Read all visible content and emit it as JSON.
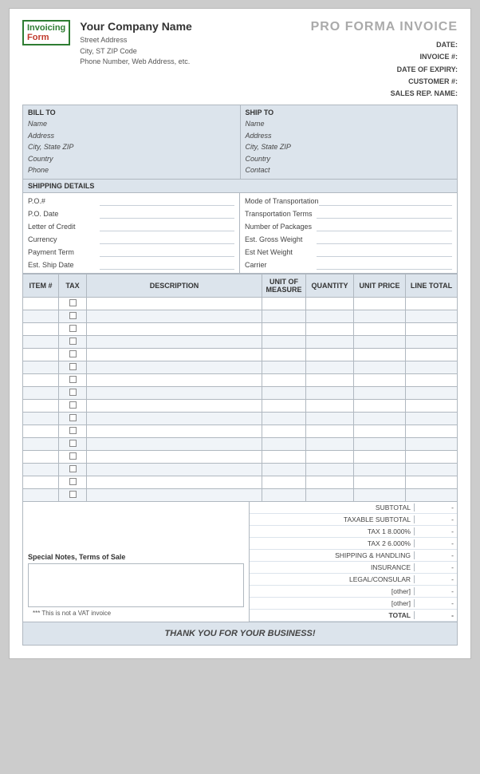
{
  "page": {
    "title": "PRO FORMA INVOICE"
  },
  "company": {
    "name": "Your Company Name",
    "address": "Street Address",
    "city_zip": "City, ST  ZIP Code",
    "phone": "Phone Number, Web Address, etc."
  },
  "logo": {
    "invoicing": "Invoicing",
    "form": "Form"
  },
  "invoice_fields": {
    "date_label": "DATE:",
    "invoice_label": "INVOICE #:",
    "expiry_label": "DATE OF EXPIRY:",
    "customer_label": "CUSTOMER #:",
    "sales_label": "SALES REP. NAME:"
  },
  "bill_to": {
    "header": "BILL TO",
    "name": "Name",
    "address": "Address",
    "city_state_zip": "City, State ZIP",
    "country": "Country",
    "phone": "Phone"
  },
  "ship_to": {
    "header": "SHIP TO",
    "name": "Name",
    "address": "Address",
    "city_state_zip": "City, State ZIP",
    "country": "Country",
    "contact": "Contact"
  },
  "shipping_details": {
    "header": "SHIPPING DETAILS",
    "fields_left": [
      "P.O.#",
      "P.O. Date",
      "Letter of Credit",
      "Currency",
      "Payment Term",
      "Est. Ship Date"
    ],
    "fields_right": [
      "Mode of Transportation",
      "Transportation Terms",
      "Number of Packages",
      "Est. Gross Weight",
      "Est Net Weight",
      "Carrier"
    ]
  },
  "table": {
    "headers": {
      "item": "ITEM #",
      "tax": "TAX",
      "description": "DESCRIPTION",
      "unit": "UNIT OF MEASURE",
      "quantity": "QUANTITY",
      "unit_price": "UNIT PRICE",
      "line_total": "LINE TOTAL"
    },
    "rows": 16
  },
  "totals": [
    {
      "label": "SUBTOTAL",
      "value": "-",
      "bold": false
    },
    {
      "label": "TAXABLE SUBTOTAL",
      "value": "-",
      "bold": false
    },
    {
      "label": "TAX 1",
      "rate": "8.000%",
      "value": "-",
      "bold": false
    },
    {
      "label": "TAX 2",
      "rate": "6.000%",
      "value": "-",
      "bold": false
    },
    {
      "label": "SHIPPING & HANDLING",
      "value": "-",
      "bold": false
    },
    {
      "label": "INSURANCE",
      "value": "-",
      "bold": false
    },
    {
      "label": "LEGAL/CONSULAR",
      "value": "-",
      "bold": false
    },
    {
      "label": "[other]",
      "value": "-",
      "bold": false
    },
    {
      "label": "[other]",
      "value": "-",
      "bold": false
    },
    {
      "label": "TOTAL",
      "value": "-",
      "bold": true
    }
  ],
  "notes": {
    "label": "Special Notes, Terms of Sale"
  },
  "vat_note": "*** This is not a VAT invoice",
  "thank_you": "THANK YOU FOR YOUR BUSINESS!"
}
